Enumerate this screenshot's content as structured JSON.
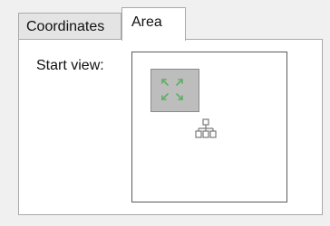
{
  "tabs": [
    {
      "label": "Coordinates",
      "selected": false
    },
    {
      "label": "Area",
      "selected": true
    }
  ],
  "panel": {
    "start_view_label": "Start view:"
  },
  "icons": {
    "zoom_area": "expand-arrows-icon",
    "center": "network-nodes-icon"
  },
  "colors": {
    "panel_background": "#ffffff",
    "window_background": "#f0f0f0",
    "zoom_area_fill": "#bdbdbd",
    "arrow_color": "#4caf50"
  }
}
